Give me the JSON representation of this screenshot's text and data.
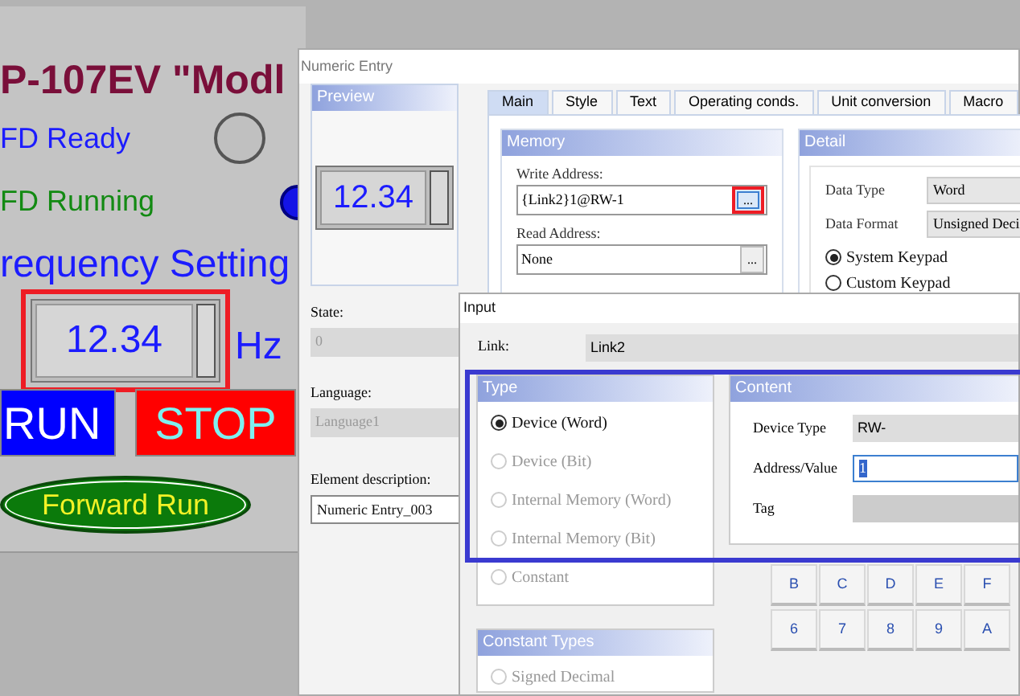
{
  "hmi_screen": {
    "title": "P-107EV \"Modl",
    "status_rows": [
      {
        "label": "FD Ready",
        "color": "#1c1cff",
        "lamp_on": false
      },
      {
        "label": "FD Running",
        "color": "#138a13",
        "lamp_on": true
      }
    ],
    "frequency_label": "requency Setting",
    "numeric_entry": {
      "value": "12.34",
      "selected": true
    },
    "unit": "Hz",
    "buttons": [
      {
        "label": "RUN",
        "color": "#0000ff"
      },
      {
        "label": "STOP",
        "color": "#ff0000"
      }
    ],
    "indicator": "Forward Run"
  },
  "numeric_entry_dialog": {
    "title": "Numeric Entry",
    "preview": {
      "title": "Preview",
      "value": "12.34"
    },
    "fields": [
      {
        "label": "State:",
        "value": "0",
        "disabled": true
      },
      {
        "label": "Language:",
        "value": "Language1",
        "disabled": true
      },
      {
        "label": "Element description:",
        "value": "Numeric Entry_003",
        "disabled": false
      }
    ],
    "tabs": [
      {
        "label": "Main",
        "selected": true
      },
      {
        "label": "Style",
        "selected": false
      },
      {
        "label": "Text",
        "selected": false
      },
      {
        "label": "Operating conds.",
        "selected": false
      },
      {
        "label": "Unit conversion",
        "selected": false
      },
      {
        "label": "Macro",
        "selected": false
      }
    ],
    "memory": {
      "title": "Memory",
      "addresses": [
        {
          "label": "Write Address:",
          "value": "{Link2}1@RW-1",
          "button": "...",
          "highlighted": true
        },
        {
          "label": "Read Address:",
          "value": "None",
          "button": "...",
          "highlighted": false
        }
      ]
    },
    "detail": {
      "title": "Detail",
      "fields": [
        {
          "label": "Data Type",
          "value": "Word"
        },
        {
          "label": "Data Format",
          "value": "Unsigned Deci"
        }
      ],
      "keypads": [
        {
          "label": "System Keypad",
          "selected": true
        },
        {
          "label": "Custom Keypad",
          "selected": false
        }
      ]
    }
  },
  "input_dialog": {
    "title": "Input",
    "link": {
      "label": "Link:",
      "value": "Link2"
    },
    "type": {
      "title": "Type",
      "options": [
        {
          "label": "Device (Word)",
          "selected": true,
          "disabled": false
        },
        {
          "label": "Device (Bit)",
          "selected": false,
          "disabled": true
        },
        {
          "label": "Internal Memory (Word)",
          "selected": false,
          "disabled": true
        },
        {
          "label": "Internal Memory (Bit)",
          "selected": false,
          "disabled": true
        },
        {
          "label": "Constant",
          "selected": false,
          "disabled": true
        }
      ]
    },
    "content": {
      "title": "Content",
      "device_type": {
        "label": "Device Type",
        "value": "RW-"
      },
      "address": {
        "label": "Address/Value",
        "value": "1"
      },
      "tag": {
        "label": "Tag"
      }
    },
    "keypad": [
      [
        "B",
        "C",
        "D",
        "E",
        "F"
      ],
      [
        "6",
        "7",
        "8",
        "9",
        "A"
      ]
    ],
    "constant_types": {
      "title": "Constant Types",
      "options": [
        {
          "label": "Signed Decimal",
          "selected": false,
          "disabled": true
        }
      ]
    }
  }
}
